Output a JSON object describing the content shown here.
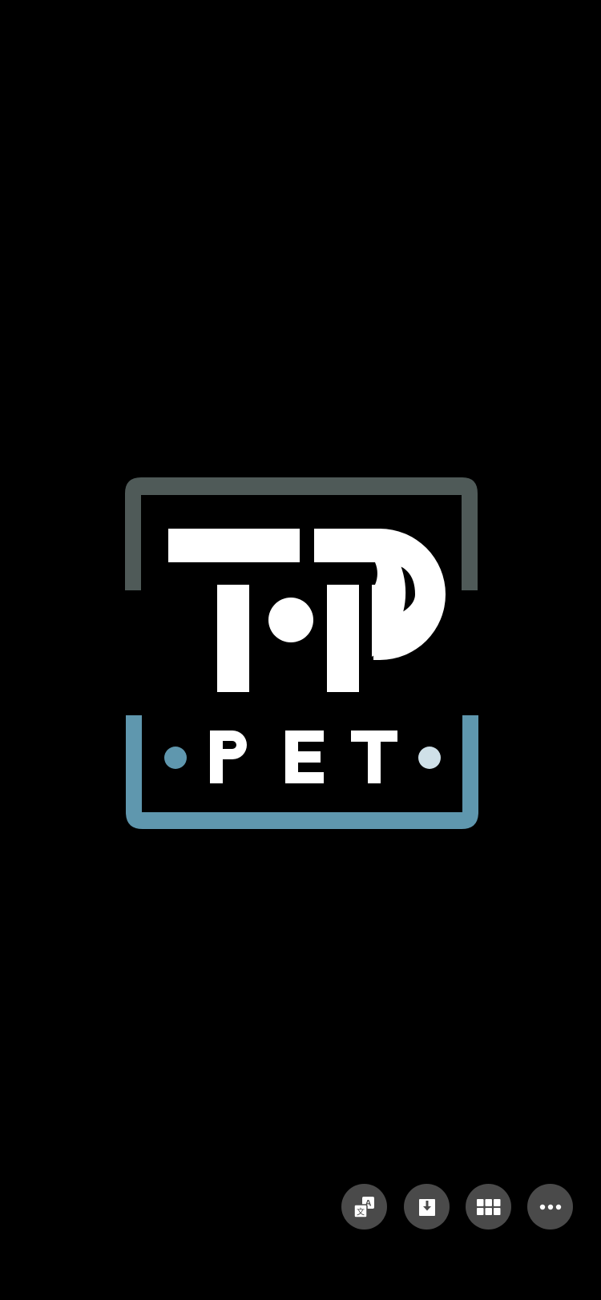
{
  "logo": {
    "monogram": "TP",
    "wordmark": "PET",
    "colors": {
      "background": "#000000",
      "frame_top": "#4f5a58",
      "frame_bottom": "#5f97ae",
      "letters": "#ffffff",
      "dot_left": "#5f97ae",
      "dot_right": "#cfe0e8"
    }
  },
  "actions": [
    {
      "icon": "translate-icon"
    },
    {
      "icon": "download-icon"
    },
    {
      "icon": "grid-icon"
    },
    {
      "icon": "more-icon"
    }
  ],
  "colors": {
    "button_background": "#4a4a4a",
    "button_icon": "#ffffff"
  }
}
